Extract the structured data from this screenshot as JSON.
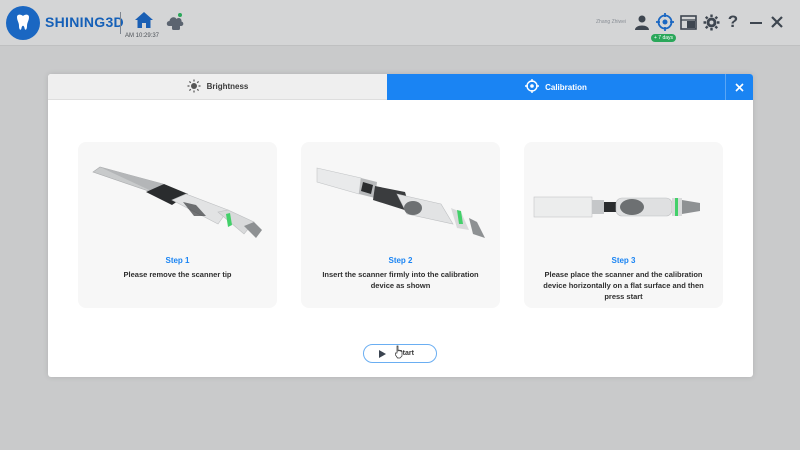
{
  "app": {
    "brand": "SHINING3D",
    "clock": "AM 10:29:37",
    "user_name": "Zhang Zhiwei",
    "days_badge": "+ 7 days"
  },
  "topbar_icons": [
    "tooth-logo-icon",
    "home-icon",
    "cloud-sync-icon",
    "user-icon",
    "scanner-connect-icon",
    "gallery-icon",
    "gear-icon",
    "help-icon",
    "minimize-icon",
    "close-icon"
  ],
  "dialog": {
    "tabs": [
      {
        "label": "Brightness",
        "icon": "sun-icon",
        "active": false
      },
      {
        "label": "Calibration",
        "icon": "crosshair-icon",
        "active": true
      }
    ],
    "steps": [
      {
        "title": "Step 1",
        "description": "Please remove the scanner tip"
      },
      {
        "title": "Step 2",
        "description": "Insert the scanner firmly into the calibration device as shown"
      },
      {
        "title": "Step 3",
        "description": "Please place the scanner and the calibration device horizontally on a flat surface and then press start"
      }
    ],
    "start_label": "Start"
  },
  "colors": {
    "accent": "#1a84f3",
    "brand": "#1560b8",
    "badge": "#2aa75a"
  }
}
